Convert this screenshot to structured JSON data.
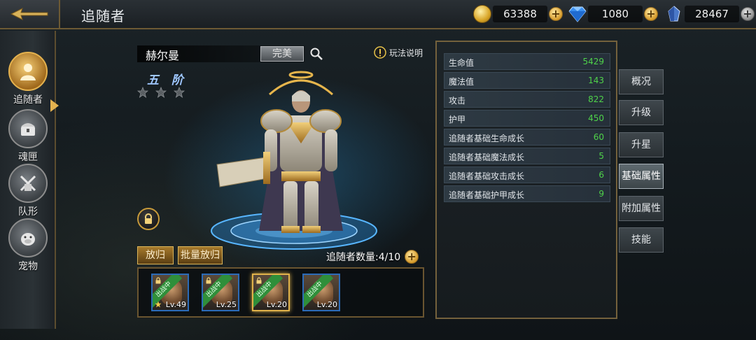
{
  "header": {
    "title": "追随者",
    "currencies": [
      {
        "name": "gold",
        "value": "63388",
        "icon": "gold-coin-icon"
      },
      {
        "name": "diamond",
        "value": "1080",
        "icon": "diamond-icon"
      },
      {
        "name": "crystal",
        "value": "28467",
        "icon": "crystal-icon"
      }
    ]
  },
  "sidebar": {
    "items": [
      {
        "label": "追随者",
        "icon": "follower-icon",
        "active": true
      },
      {
        "label": "魂匣",
        "icon": "soul-box-icon",
        "active": false
      },
      {
        "label": "队形",
        "icon": "formation-icon",
        "active": false
      },
      {
        "label": "宠物",
        "icon": "pet-icon",
        "active": false
      }
    ]
  },
  "character": {
    "name": "赫尔曼",
    "grade": "完美",
    "tier": "五 阶",
    "stars": 3,
    "rules_label": "玩法说明"
  },
  "actions": {
    "release": "放归",
    "batch_release": "批量放归",
    "count_label": "追随者数量:4/10"
  },
  "roster": [
    {
      "status": "出战中",
      "level": "Lv.49",
      "locked": true,
      "starred": true,
      "selected": false
    },
    {
      "status": "出战中",
      "level": "Lv.25",
      "locked": true,
      "starred": false,
      "selected": false
    },
    {
      "status": "出战中",
      "level": "Lv.20",
      "locked": true,
      "starred": false,
      "selected": true
    },
    {
      "status": "出战中",
      "level": "Lv.20",
      "locked": false,
      "starred": false,
      "selected": false
    }
  ],
  "attributes": [
    {
      "label": "生命值",
      "value": "5429"
    },
    {
      "label": "魔法值",
      "value": "143"
    },
    {
      "label": "攻击",
      "value": "822"
    },
    {
      "label": "护甲",
      "value": "450"
    },
    {
      "label": "追随者基础生命成长",
      "value": "60"
    },
    {
      "label": "追随者基础魔法成长",
      "value": "5"
    },
    {
      "label": "追随者基础攻击成长",
      "value": "6"
    },
    {
      "label": "追随者基础护甲成长",
      "value": "9"
    }
  ],
  "tabs": [
    {
      "label": "概况",
      "active": false
    },
    {
      "label": "升级",
      "active": false
    },
    {
      "label": "升星",
      "active": false
    },
    {
      "label": "基础属性",
      "active": true
    },
    {
      "label": "附加属性",
      "active": false
    },
    {
      "label": "技能",
      "active": false
    }
  ],
  "colors": {
    "accent_gold": "#d9b45a",
    "value_green": "#4fd34a",
    "tier_blue": "#9fc7ff"
  }
}
